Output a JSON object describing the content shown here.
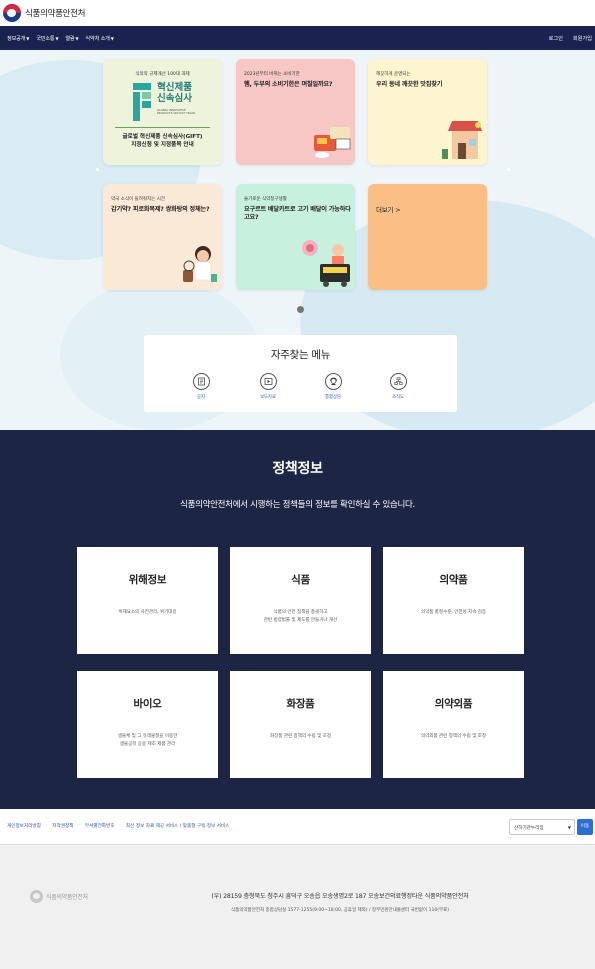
{
  "brand": "식품의약품안전처",
  "nav": {
    "items": [
      {
        "label": "정보공개"
      },
      {
        "label": "국민소통"
      },
      {
        "label": "열람"
      },
      {
        "label": "식약처 소개"
      }
    ],
    "login": "로그인",
    "signup": "회원가입"
  },
  "colors": {
    "navbar": "#1a2350",
    "policy_bg": "#1c2644",
    "link": "#2a4fa3"
  },
  "banners": [
    {
      "sub": "식의약 규제개선 100대 과제",
      "logo_text": "혁신제품\n신속심사",
      "logo_tiny": "GLOBAL INNOVATIVE\nPRODUCTS ON FAST TRACK",
      "desc1": "글로벌 혁신제품 신속심사(GIFT)",
      "desc2": "지정신청 및 지정품목 안내"
    },
    {
      "sub": "2023년부터 바뀌는 소비기한",
      "title": "햄, 두부의 소비기한은 며칠일까요?"
    },
    {
      "sub": "깨끗하게 운영되는",
      "title": "우리 동네 깨끗한 맛집찾기"
    },
    {
      "sub": "약국 소식이 들려줘지는 시간",
      "title": "감기약? 피로회복제? 쌍화탕의 정체는?"
    },
    {
      "sub": "슬기로운 식약청구생활",
      "title": "요구르트 배달카트로 고기 배달이 가능하다고요?"
    },
    {
      "sub": "",
      "title": "더보기 >"
    }
  ],
  "quick_menu": {
    "title": "자주찾는 메뉴",
    "items": [
      {
        "label": "공지",
        "icon": "notice-icon"
      },
      {
        "label": "보도자료",
        "icon": "press-icon"
      },
      {
        "label": "통합상담",
        "icon": "consult-icon"
      },
      {
        "label": "조직도",
        "icon": "org-icon"
      }
    ]
  },
  "policy": {
    "title": "정책정보",
    "subtitle": "식품의약안전처에서 시행하는 정책들의 정보를 확인하실 수 있습니다.",
    "cards": [
      {
        "title": "위해정보",
        "line1": "위해요소의 사전관리, 위기대응",
        "line2": ""
      },
      {
        "title": "식품",
        "line1": "식품의 안전 정책을 총괄하고",
        "line2": "관련 법령법률 및 제도를 만들거나 개선"
      },
      {
        "title": "의약품",
        "line1": "의약품 품질수준, 안전성 지속 검증",
        "line2": ""
      },
      {
        "title": "바이오",
        "line1": "생물체 및 그 유래물질을 이용한",
        "line2": "생물공학 응용 제조 제품 관리"
      },
      {
        "title": "화장품",
        "line1": "화장품 관련 정책의 수립 및 조정",
        "line2": ""
      },
      {
        "title": "의약외품",
        "line1": "의약외품 관련 정책의 수립 및 조정",
        "line2": ""
      }
    ]
  },
  "footer": {
    "links": [
      "개인정보처리방침",
      "저작권정책",
      "부서별전화번호",
      "최신 정보 자료 제공 서비스 / 맞춤형 구독 정보 서비스"
    ],
    "select_label": "산하기관누리집",
    "go_label": "이동",
    "logo_text": "식품의약품안전처",
    "address": "(우) 28159 충청북도 청주시 흥덕구 오송읍 오송생명2로 187 오송보건의료행정타운 식품의약품안전처",
    "contact": "식품의약품안전처 종합상담실 1577-1255(9:00~18:00, 공휴일 제외) / 정부민원안내콜센터 국번없이 110(무료)"
  }
}
